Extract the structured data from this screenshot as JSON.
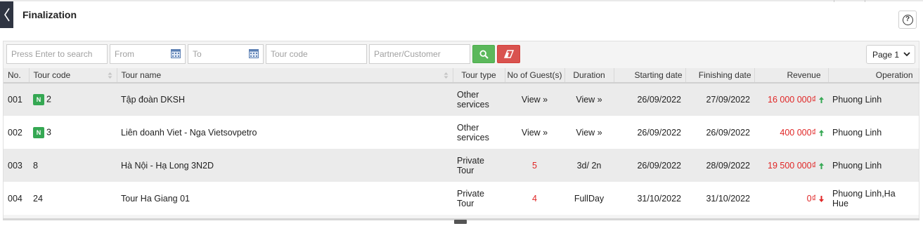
{
  "header": {
    "title": "Finalization"
  },
  "filters": {
    "search_placeholder": "Press Enter to search",
    "from_placeholder": "From",
    "to_placeholder": "To",
    "tour_code_placeholder": "Tour code",
    "partner_placeholder": "Partner/Customer",
    "page_selected": "Page 1"
  },
  "colors": {
    "search_button": "#5cb85c",
    "clear_button": "#d9534f",
    "revenue_text": "#e02626",
    "new_badge": "#35a853",
    "back_button": "#2f3542"
  },
  "table": {
    "columns": [
      "No.",
      "Tour code",
      "Tour name",
      "Tour type",
      "No of Guest(s)",
      "Duration",
      "Starting date",
      "Finishing date",
      "Revenue",
      "Operation"
    ],
    "rows": [
      {
        "no": "001",
        "badge": "N",
        "tour_code": "2",
        "tour_name": "Tập đoàn DKSH",
        "tour_type_1": "Other",
        "tour_type_2": "services",
        "guests": "View »",
        "duration": "View »",
        "start": "26/09/2022",
        "finish": "27/09/2022",
        "revenue": "16 000 000₫",
        "revenue_trend": "up",
        "operation_1": "Phuong Linh",
        "operation_2": ""
      },
      {
        "no": "002",
        "badge": "N",
        "tour_code": "3",
        "tour_name": "Liên doanh Viet - Nga Vietsovpetro",
        "tour_type_1": "Other",
        "tour_type_2": "services",
        "guests": "View »",
        "duration": "View »",
        "start": "26/09/2022",
        "finish": "26/09/2022",
        "revenue": "400 000₫",
        "revenue_trend": "up",
        "operation_1": "Phuong Linh",
        "operation_2": ""
      },
      {
        "no": "003",
        "badge": "",
        "tour_code": "8",
        "tour_name": "Hà Nội - Hạ Long 3N2D",
        "tour_type_1": "Private",
        "tour_type_2": "Tour",
        "guests": "5",
        "duration": "3d/ 2n",
        "start": "26/09/2022",
        "finish": "28/09/2022",
        "revenue": "19 500 000₫",
        "revenue_trend": "up",
        "operation_1": "Phuong Linh",
        "operation_2": ""
      },
      {
        "no": "004",
        "badge": "",
        "tour_code": "24",
        "tour_name": "Tour Ha Giang 01",
        "tour_type_1": "Private",
        "tour_type_2": "Tour",
        "guests": "4",
        "duration": "FullDay",
        "start": "31/10/2022",
        "finish": "31/10/2022",
        "revenue": "0₫",
        "revenue_trend": "down",
        "operation_1": "Phuong Linh,Ha",
        "operation_2": "Hue"
      }
    ]
  }
}
